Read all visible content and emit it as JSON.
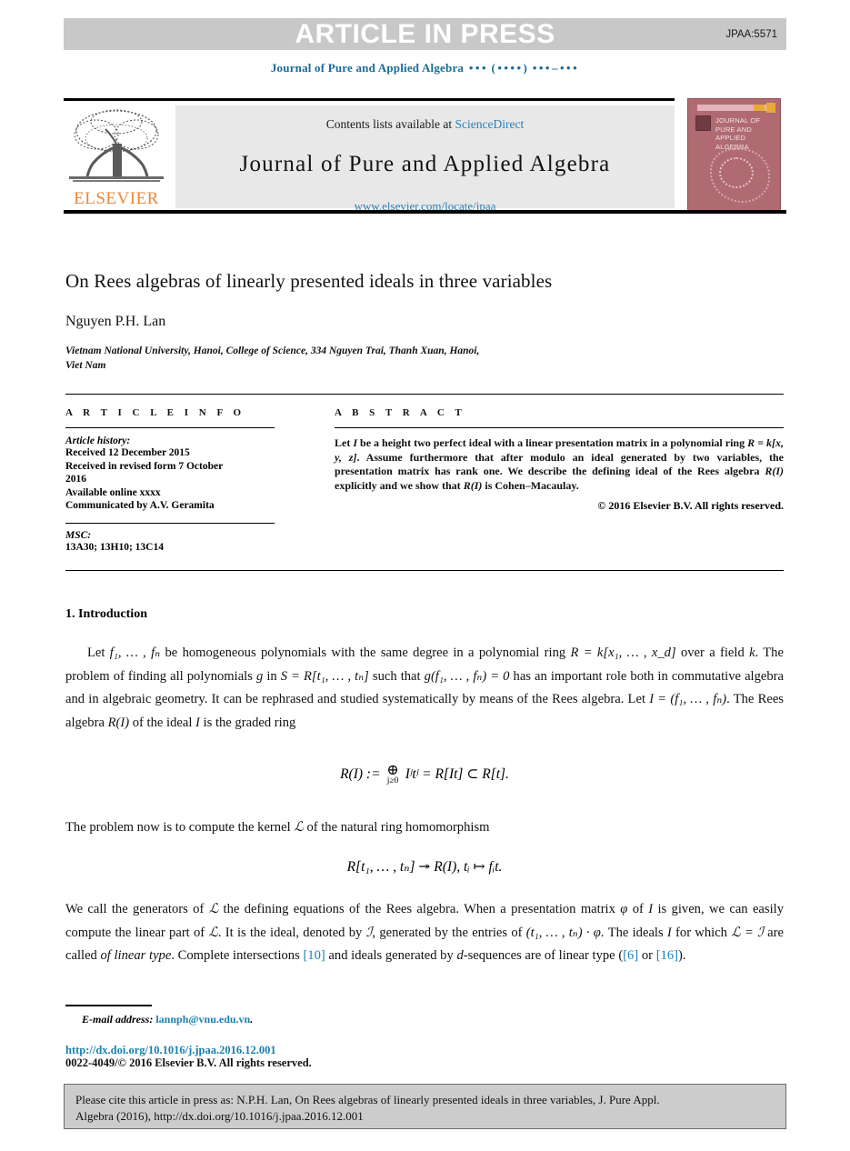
{
  "banner": {
    "article_in_press": "ARTICLE IN PRESS",
    "manuscript_code": "JPAA:5571"
  },
  "running_head": {
    "journal": "Journal of Pure and Applied Algebra",
    "volume_dots": "•••",
    "year_dots": "(••••)",
    "pages_dots": "•••–•••"
  },
  "masthead": {
    "contents_label": "Contents lists available at",
    "sciencedirect": "ScienceDirect",
    "journal_title": "Journal of Pure and Applied Algebra",
    "journal_url": "www.elsevier.com/locate/jpaa",
    "publisher": "ELSEVIER",
    "cover_title_lines": [
      "JOURNAL OF",
      "PURE AND",
      "APPLIED ALGEBRA"
    ]
  },
  "article": {
    "title": "On Rees algebras of linearly presented ideals in three variables",
    "author": "Nguyen P.H. Lan",
    "affiliation_line1": "Vietnam National University, Hanoi, College of Science, 334 Nguyen Trai, Thanh Xuan, Hanoi,",
    "affiliation_line2": "Viet Nam"
  },
  "article_info": {
    "heading": "A R T I C L E   I N F O",
    "history_label": "Article history:",
    "history_lines": [
      "Received 12 December 2015",
      "Received in revised form 7 October",
      "2016",
      "Available online xxxx",
      "Communicated by A.V. Geramita"
    ],
    "msc_label": "MSC:",
    "msc_codes": "13A30; 13H10; 13C14"
  },
  "abstract": {
    "heading": "A B S T R A C T",
    "text_part1": "Let ",
    "text_I": "I",
    "text_part2": " be a height two perfect ideal with a linear presentation matrix in a polynomial ring ",
    "ring_expr": "R = k[x, y, z]",
    "text_part3": ". Assume furthermore that after modulo an ideal generated by two variables, the presentation matrix has rank one. We describe the defining ideal of the Rees algebra ",
    "rees_expr": "R(I)",
    "text_part4": " explicitly and we show that ",
    "text_part5": " is Cohen–Macaulay.",
    "copyright": "© 2016 Elsevier B.V. All rights reserved."
  },
  "body": {
    "section_heading": "1. Introduction",
    "para1_a": "Let ",
    "para1_f": "f₁, … , fₙ",
    "para1_b": " be homogeneous polynomials with the same degree in a polynomial ring ",
    "para1_R": "R = k[x₁, … , x_d]",
    "para1_c": " over a field ",
    "para1_k": "k",
    "para1_d": ". The problem of finding all polynomials ",
    "para1_g": "g",
    "para1_e": " in ",
    "para1_S": "S = R[t₁, … , tₙ]",
    "para1_g2": " such that ",
    "para1_gf": "g(f₁, … , fₙ) = 0",
    "para1_h": " has an important role both in commutative algebra and in algebraic geometry. It can be rephrased and studied systematically by means of the Rees algebra. Let ",
    "para1_I": "I = (f₁, … , fₙ)",
    "para1_i": ". The Rees algebra ",
    "para1_RI": "R(I)",
    "para1_j": " of the ideal ",
    "para1_I2": "I",
    "para1_k2": " is the graded ring",
    "eq1_lhs": "R(I) :=",
    "eq1_oplus": "⊕",
    "eq1_sub": "j≥0",
    "eq1_mid": "Iʲtʲ = R[It] ⊂ R[t].",
    "para2": "The problem now is to compute the kernel ",
    "para2_L": "ℒ",
    "para2_b": " of the natural ring homomorphism",
    "eq2": "R[t₁, … , tₙ] ↠ R(I), tᵢ ↦ fᵢt.",
    "para3_a": "We call the generators of ",
    "para3_L": "ℒ",
    "para3_b": " the defining equations of the Rees algebra. When a presentation matrix ",
    "para3_phi": "φ",
    "para3_c": " of ",
    "para3_I": "I",
    "para3_d": " is given, we can easily compute the linear part of ",
    "para3_e": ". It is the ideal, denoted by ",
    "para3_J": "ℐ",
    "para3_f": ", generated by the entries of ",
    "para3_tphi": "(t₁, … , tₙ) · φ",
    "para3_g": ". The ideals ",
    "para3_h": " for which ",
    "para3_LJ": "ℒ = ℐ",
    "para3_i": " are called ",
    "para3_lin": "of linear type",
    "para3_j": ". Complete intersections ",
    "cite_10": "[10]",
    "para3_k": " and ideals generated by ",
    "para3_d2": "d",
    "para3_l": "-sequences are of linear type (",
    "cite_6": "[6]",
    "para3_or": " or ",
    "cite_16": "[16]",
    "para3_m": ")."
  },
  "footer": {
    "email_label": "E-mail address:",
    "email_address": "lannph@vnu.edu.vn",
    "email_period": ".",
    "doi": "http://dx.doi.org/10.1016/j.jpaa.2016.12.001",
    "issn_copyright": "0022-4049/© 2016 Elsevier B.V. All rights reserved."
  },
  "cite_box": {
    "line1": "Please cite this article in press as: N.P.H. Lan, On Rees algebras of linearly presented ideals in three variables, J. Pure Appl.",
    "line2": "Algebra (2016), http://dx.doi.org/10.1016/j.jpaa.2016.12.001"
  },
  "colors": {
    "link": "#1a7fae",
    "banner_bg": "#c8c8c8",
    "elsevier_orange": "#e8883a",
    "cover_bg": "#b06a72"
  }
}
